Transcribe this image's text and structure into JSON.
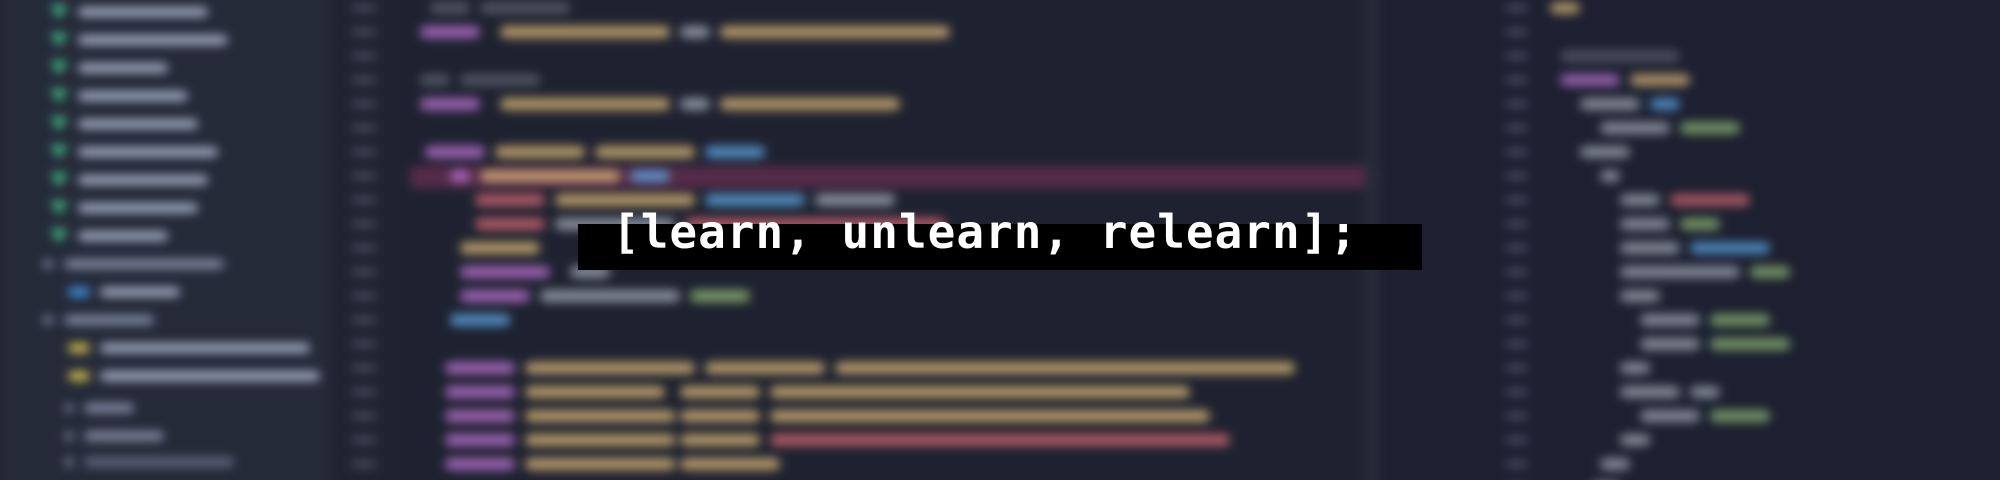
{
  "headline": {
    "text": "[learn, unlearn, relearn];"
  },
  "colors": {
    "background": "#1e2230",
    "panel": "#252a39",
    "banner": "#000000",
    "headline_text": "#ffffff",
    "vue_green": "#41b883",
    "keyword_purple": "#c678dd",
    "variable_yellow": "#e5c07b",
    "string_green": "#98c379",
    "highlight_pink": "#be3c78"
  },
  "background_description_icons": {
    "file_icon": "vue-file-icon",
    "folder_icon": "folder-icon",
    "json_icon": "json-file-icon"
  }
}
